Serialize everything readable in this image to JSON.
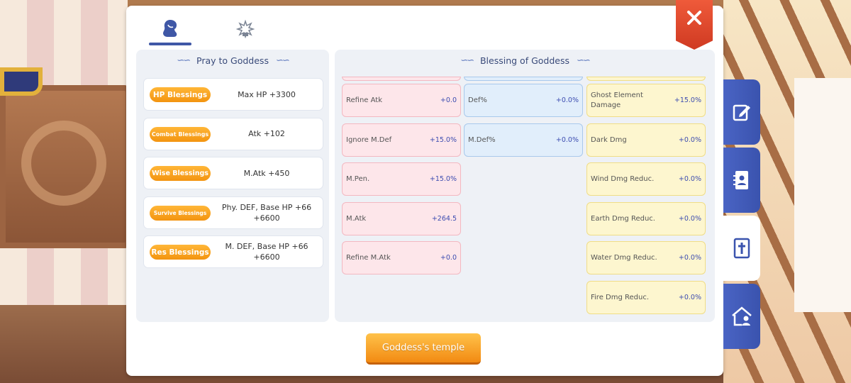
{
  "tabs": [
    {
      "icon": "goddess-hair-icon",
      "active": true
    },
    {
      "icon": "angel-statue-icon",
      "active": false
    }
  ],
  "close_icon": "close-icon",
  "pray_panel": {
    "title": "Pray to Goddess",
    "items": [
      {
        "label": "HP Blessings",
        "value": "Max HP  +3300"
      },
      {
        "label": "Combat Blessings",
        "value": "Atk +102"
      },
      {
        "label": "Wise Blessings",
        "value": "M.Atk +450"
      },
      {
        "label": "Survive Blessings",
        "value": "Phy. DEF, Base HP +66 +6600"
      },
      {
        "label": "Res Blessings",
        "value": "M. DEF, Base HP +66 +6600"
      }
    ]
  },
  "blessing_panel": {
    "title": "Blessing of Goddess",
    "col1": [
      {
        "name": "Refine Atk",
        "value": "+0.0"
      },
      {
        "name": "Ignore M.Def",
        "value": "+15.0%"
      },
      {
        "name": "M.Pen.",
        "value": "+15.0%"
      },
      {
        "name": "M.Atk",
        "value": "+264.5"
      },
      {
        "name": "Refine M.Atk",
        "value": "+0.0"
      }
    ],
    "col2": [
      {
        "name": "Def%",
        "value": "+0.0%"
      },
      {
        "name": "M.Def%",
        "value": "+0.0%"
      }
    ],
    "col3": [
      {
        "name": "Ghost Element Damage",
        "value": "+15.0%"
      },
      {
        "name": "Dark Dmg",
        "value": "+0.0%"
      },
      {
        "name": "Wind Dmg Reduc.",
        "value": "+0.0%"
      },
      {
        "name": "Earth Dmg Reduc.",
        "value": "+0.0%"
      },
      {
        "name": "Water Dmg Reduc.",
        "value": "+0.0%"
      },
      {
        "name": "Fire Dmg Reduc.",
        "value": "+0.0%"
      }
    ]
  },
  "temple_button": "Goddess's temple",
  "side_tabs": [
    {
      "icon": "edit-note-icon",
      "active": false
    },
    {
      "icon": "contact-book-icon",
      "active": false
    },
    {
      "icon": "cross-book-icon",
      "active": true
    },
    {
      "icon": "house-person-icon",
      "active": false
    }
  ],
  "colors": {
    "accent": "#f39410",
    "close": "#e04a2f",
    "tab": "#3f57a6"
  }
}
